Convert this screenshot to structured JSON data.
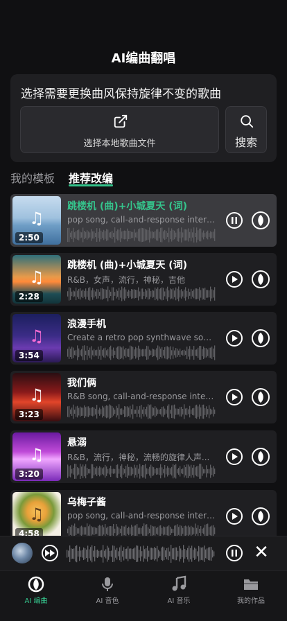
{
  "header": {
    "title": "AI编曲翻唱"
  },
  "upload": {
    "prompt": "选择需要更换曲风保持旋律不变的歌曲",
    "local_button_label": "选择本地歌曲文件",
    "search_button_label": "搜索"
  },
  "tabs": [
    {
      "label": "我的模板",
      "active": false
    },
    {
      "label": "推荐改编",
      "active": true
    }
  ],
  "songs": [
    {
      "title": "跳楼机 (曲)+小城夏天 (词)",
      "desc": "pop song, call-and-response interl...",
      "duration": "2:50",
      "state": "playing",
      "active": true
    },
    {
      "title": "跳楼机 (曲)+小城夏天 (词)",
      "desc": "R&B，女声，流行，神秘，吉他",
      "duration": "2:28",
      "state": "paused",
      "active": false
    },
    {
      "title": "浪漫手机",
      "desc": "Create a retro pop synthwave song...",
      "duration": "3:54",
      "state": "paused",
      "active": false
    },
    {
      "title": "我们俩",
      "desc": "R&B song, call-and-response inter...",
      "duration": "3:23",
      "state": "paused",
      "active": false
    },
    {
      "title": "悬溺",
      "desc": "R&B，流行，神秘，流畅的旋律人声...",
      "duration": "3:20",
      "state": "paused",
      "active": false
    },
    {
      "title": "乌梅子酱",
      "desc": "pop song, call-and-response interl...",
      "duration": "4:58",
      "state": "paused",
      "active": false
    }
  ],
  "bottom_nav": [
    {
      "label": "AI 编曲",
      "icon": "remix-icon",
      "active": true
    },
    {
      "label": "AI 音色",
      "icon": "microphone-icon",
      "active": false
    },
    {
      "label": "AI 音乐",
      "icon": "music-note-icon",
      "active": false
    },
    {
      "label": "我的作品",
      "icon": "folder-icon",
      "active": false
    }
  ],
  "colors": {
    "accent": "#35c48c",
    "background": "#101012",
    "card": "#1f1f22"
  }
}
